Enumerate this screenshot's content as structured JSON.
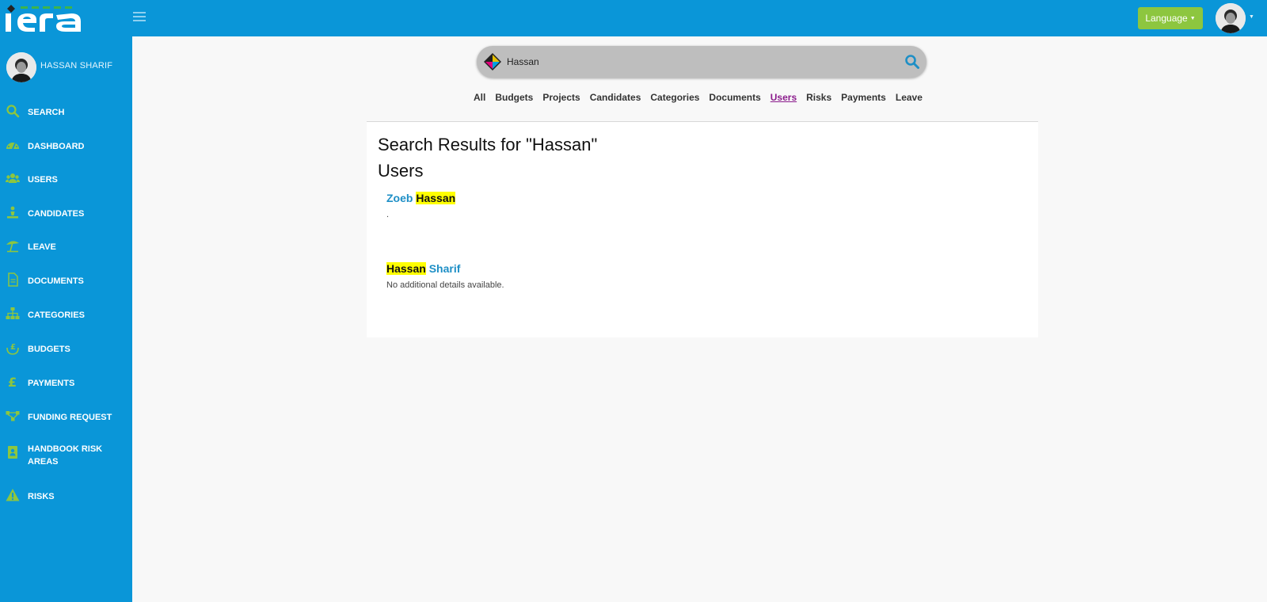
{
  "header": {
    "language_label": "Language"
  },
  "sidebar": {
    "user_name": "HASSAN SHARIF",
    "items": [
      {
        "label": "SEARCH",
        "icon": "search-icon"
      },
      {
        "label": "DASHBOARD",
        "icon": "dashboard-icon"
      },
      {
        "label": "USERS",
        "icon": "users-icon"
      },
      {
        "label": "CANDIDATES",
        "icon": "candidates-icon"
      },
      {
        "label": "LEAVE",
        "icon": "beach-umbrella-icon"
      },
      {
        "label": "DOCUMENTS",
        "icon": "document-icon"
      },
      {
        "label": "CATEGORIES",
        "icon": "sitemap-icon"
      },
      {
        "label": "BUDGETS",
        "icon": "budget-icon"
      },
      {
        "label": "PAYMENTS",
        "icon": "pound-icon"
      },
      {
        "label": "FUNDING REQUEST",
        "icon": "flow-icon"
      },
      {
        "label": "HANDBOOK RISK AREAS",
        "icon": "handbook-icon"
      },
      {
        "label": "RISKS",
        "icon": "warning-icon"
      }
    ]
  },
  "search": {
    "value": "Hassan",
    "filters": [
      "All",
      "Budgets",
      "Projects",
      "Candidates",
      "Categories",
      "Documents",
      "Users",
      "Risks",
      "Payments",
      "Leave"
    ],
    "active_filter": "Users"
  },
  "results": {
    "title": "Search Results for \"Hassan\"",
    "section": "Users",
    "items": [
      {
        "first": "Zoeb",
        "second": "Hassan",
        "detail": "."
      },
      {
        "first": "Hassan",
        "second": "Sharif",
        "detail": "No additional details available."
      }
    ]
  },
  "colors": {
    "primary": "#0a96d8",
    "accent": "#8dc63f",
    "link": "#1e8fc6",
    "highlight": "#ffff00",
    "active_filter": "#8b1c8c"
  }
}
